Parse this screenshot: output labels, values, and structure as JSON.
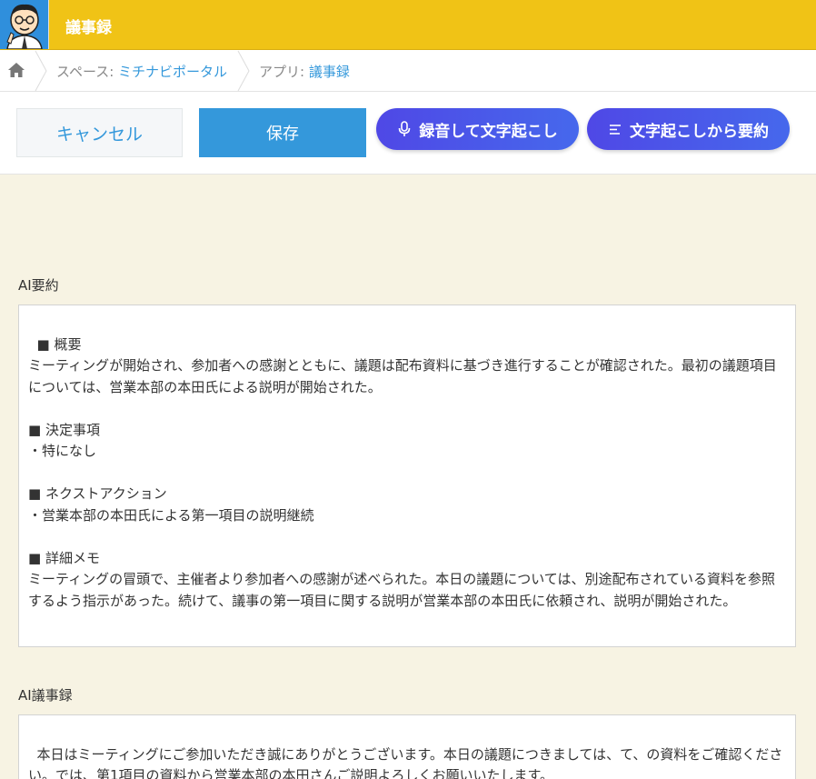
{
  "header": {
    "app_icon": "cartoon-person-avatar-icon",
    "title": "議事録",
    "accent_color": "#f0c316"
  },
  "breadcrumb": {
    "home_icon": "home-icon",
    "space_prefix": "スペース: ",
    "space_name": "ミチナビポータル",
    "app_prefix": "アプリ: ",
    "app_name": "議事録"
  },
  "toolbar": {
    "cancel_label": "キャンセル",
    "save_label": "保存",
    "record_label": "録音して文字起こし",
    "record_icon": "microphone-icon",
    "summarize_label": "文字起こしから要約",
    "summarize_icon": "text-lines-icon"
  },
  "fields": {
    "ai_summary_label": "AI要約",
    "ai_summary_text": "■ 概要\nミーティングが開始され、参加者への感謝とともに、議題は配布資料に基づき進行することが確認された。最初の議題項目については、営業本部の本田氏による説明が開始された。\n\n■ 決定事項\n・特になし\n\n■ ネクストアクション\n・営業本部の本田氏による第一項目の説明継続\n\n■ 詳細メモ\nミーティングの冒頭で、主催者より参加者への感謝が述べられた。本日の議題については、別途配布されている資料を参照するよう指示があった。続けて、議事の第一項目に関する説明が営業本部の本田氏に依頼され、説明が開始された。",
    "ai_minutes_label": "AI議事録",
    "ai_minutes_text": "本日はミーティングにご参加いただき誠にありがとうございます。本日の議題につきましては、て、の資料をご確認ください。では、第1項目の資料から営業本部の本田さんご説明よろしくお願いいたします。"
  }
}
